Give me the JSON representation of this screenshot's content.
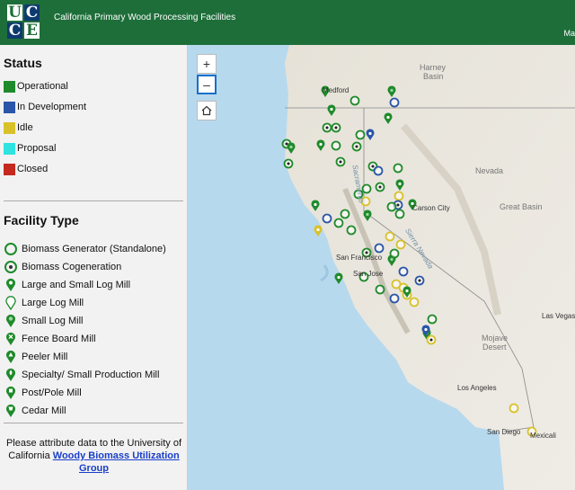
{
  "header": {
    "logo": [
      "U",
      "C",
      "C",
      "E"
    ],
    "title": "California Primary Wood Processing Facilities",
    "map_link": "Ma"
  },
  "status": {
    "heading": "Status",
    "items": [
      {
        "label": "Operational",
        "color": "#1f8a2b"
      },
      {
        "label": "In Development",
        "color": "#2a55a8"
      },
      {
        "label": "Idle",
        "color": "#d8c22a"
      },
      {
        "label": "Proposal",
        "color": "#2ee3e0"
      },
      {
        "label": "Closed",
        "color": "#c42a20"
      }
    ]
  },
  "facility_type": {
    "heading": "Facility Type",
    "items": [
      {
        "label": "Biomass Generator (Standalone)",
        "icon": "ring-icon"
      },
      {
        "label": "Biomass Cogeneration",
        "icon": "ring-dot-icon"
      },
      {
        "label": "Large and Small Log Mill",
        "icon": "pin-icon"
      },
      {
        "label": "Large Log Mill",
        "icon": "pin-outline-icon"
      },
      {
        "label": "Small Log Mill",
        "icon": "pin-dot-icon"
      },
      {
        "label": "Fence Board Mill",
        "icon": "pin-x-icon"
      },
      {
        "label": "Peeler Mill",
        "icon": "pin-triangle-icon"
      },
      {
        "label": "Specialty/ Small Production Mill",
        "icon": "pin-leaf-icon"
      },
      {
        "label": "Post/Pole Mill",
        "icon": "pin-square-icon"
      },
      {
        "label": "Cedar Mill",
        "icon": "pin-cup-icon"
      }
    ]
  },
  "attribution": {
    "text": "Please attribute data to the University of California",
    "link": "Woody Biomass Utilization Group"
  },
  "map": {
    "zoom_in": "+",
    "zoom_out": "–",
    "labels": {
      "medford": "Medford",
      "harney": "Harney",
      "basin": "Basin",
      "nevada": "Nevada",
      "carson": "Carson City",
      "sf": "San Francisco",
      "sj": "San Jose",
      "greatbasin": "Great Basin",
      "lasvegas": "Las Vegas",
      "mojave1": "Mojave",
      "mojave2": "Desert",
      "la": "Los Angeles",
      "sd": "San Diego",
      "mexicali": "Mexicali",
      "sierra": "Sierra Nevada",
      "sac": "Sacramento"
    },
    "colors": {
      "land": "#eceae4",
      "water": "#b7d9ee",
      "green": "#1f8a2b",
      "blue": "#2a55a8",
      "yellow": "#d8c22a"
    }
  }
}
